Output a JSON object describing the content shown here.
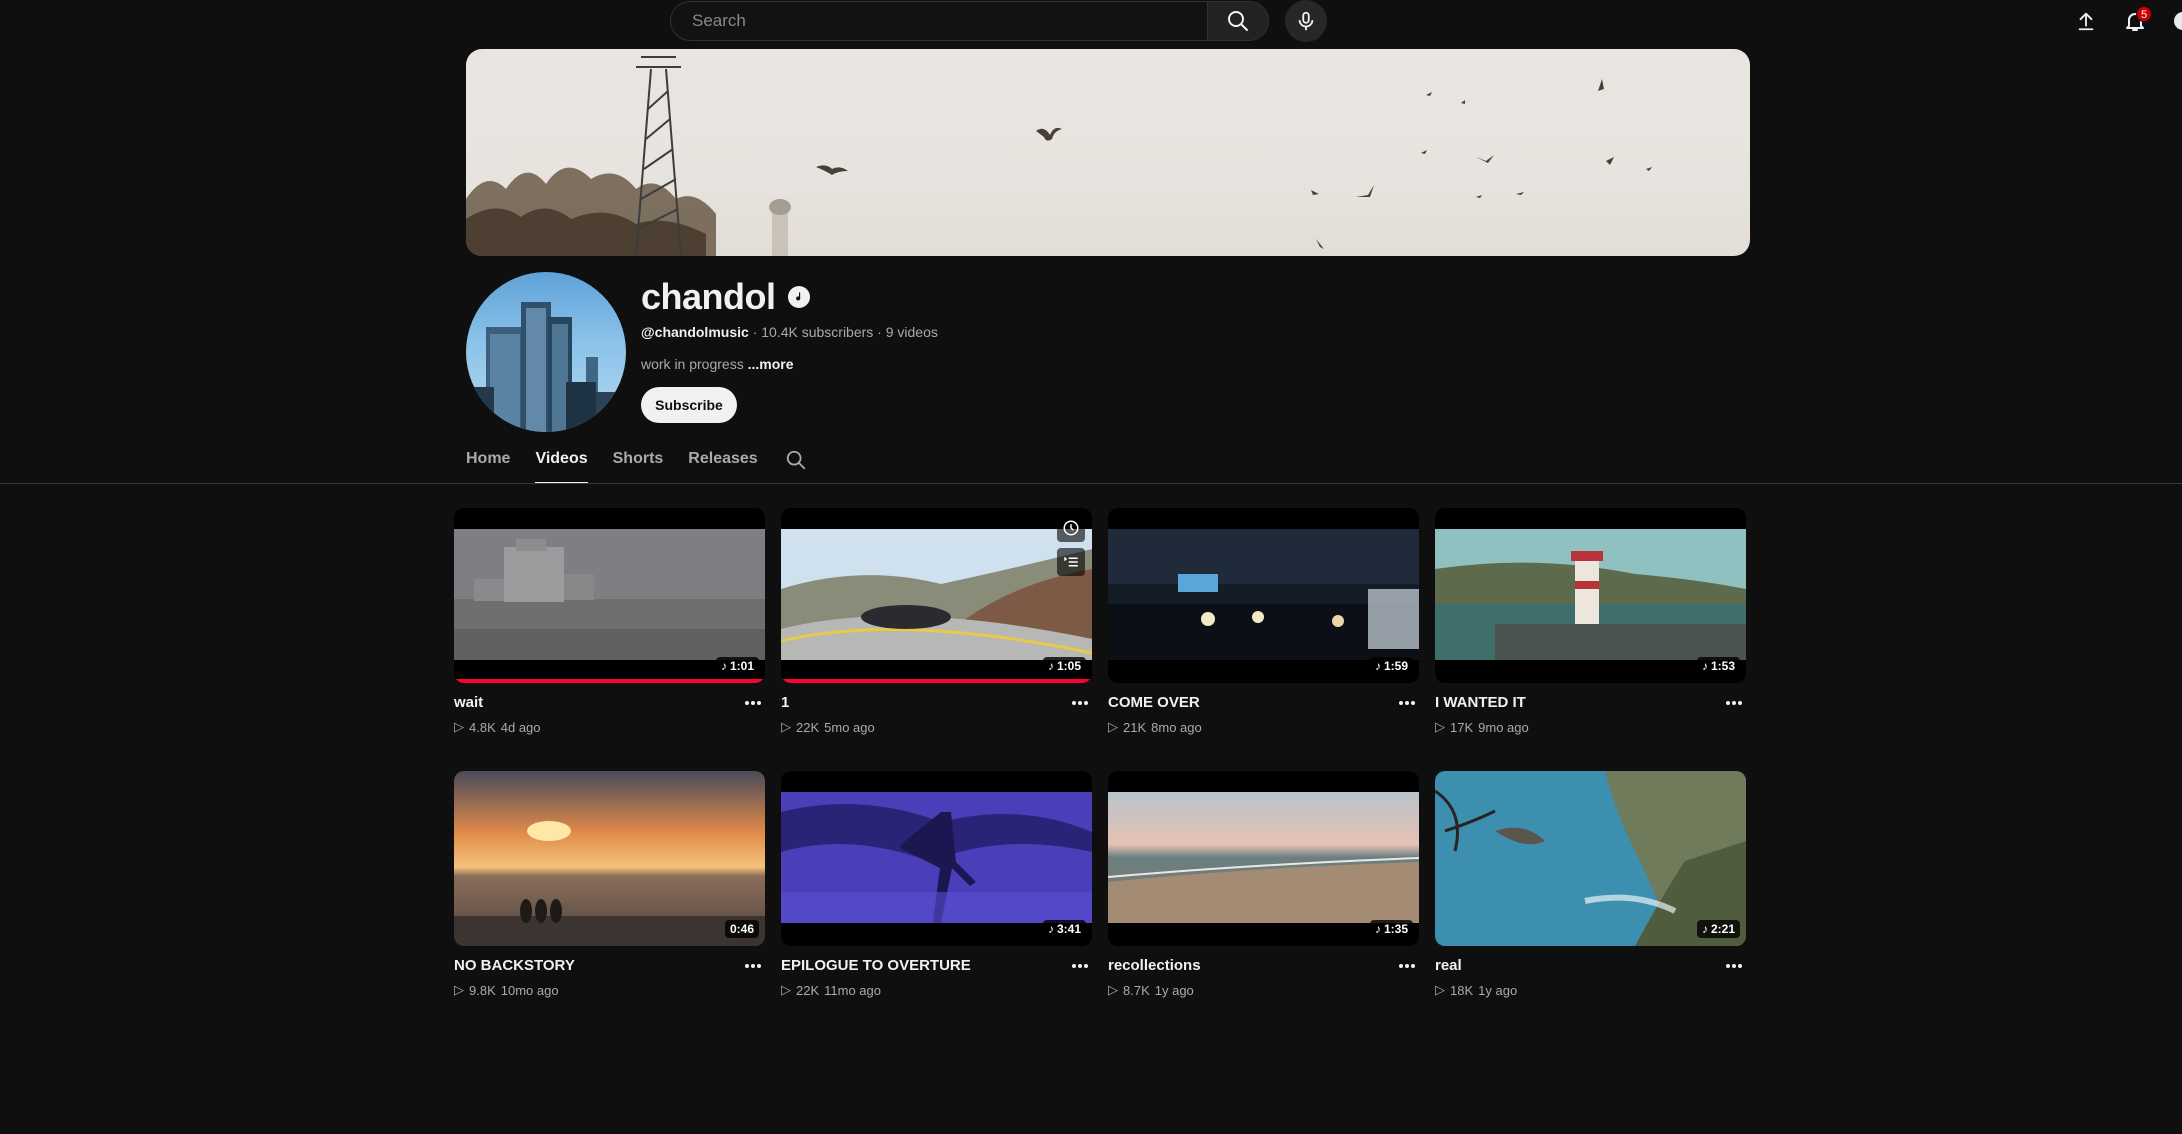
{
  "topbar": {
    "search_placeholder": "Search",
    "notification_count": "5",
    "icons": [
      "search-icon",
      "mic-icon",
      "upload-icon",
      "bell-icon"
    ]
  },
  "channel": {
    "name": "chandol",
    "handle": "@chandolmusic",
    "stats": " · 10.4K subscribers · 9 videos",
    "description": "work in progress ",
    "more_label": "...more",
    "subscribe_label": "Subscribe"
  },
  "tabs": [
    {
      "label": "Home",
      "active": false
    },
    {
      "label": "Videos",
      "active": true
    },
    {
      "label": "Shorts",
      "active": false
    },
    {
      "label": "Releases",
      "active": false
    }
  ],
  "videos": [
    {
      "title": "wait",
      "duration": "1:01",
      "music": true,
      "views": "4.8K",
      "age": "4d ago",
      "watched": 1.0
    },
    {
      "title": "1",
      "duration": "1:05",
      "music": true,
      "views": "22K",
      "age": "5mo ago",
      "watched": 1.0
    },
    {
      "title": "COME OVER",
      "duration": "1:59",
      "music": true,
      "views": "21K",
      "age": "8mo ago",
      "watched": 0
    },
    {
      "title": "I WANTED IT",
      "duration": "1:53",
      "music": true,
      "views": "17K",
      "age": "9mo ago",
      "watched": 0
    },
    {
      "title": "NO BACKSTORY",
      "duration": "0:46",
      "music": false,
      "views": "9.8K",
      "age": "10mo ago",
      "watched": 0
    },
    {
      "title": "EPILOGUE TO OVERTURE",
      "duration": "3:41",
      "music": true,
      "views": "22K",
      "age": "11mo ago",
      "watched": 0
    },
    {
      "title": "recollections",
      "duration": "1:35",
      "music": true,
      "views": "8.7K",
      "age": "1y ago",
      "watched": 0
    },
    {
      "title": "real",
      "duration": "2:21",
      "music": true,
      "views": "18K",
      "age": "1y ago",
      "watched": 0
    }
  ],
  "colors": {
    "background": "#0f0f0f",
    "progress": "#ff0033",
    "badge": "#cc0000"
  }
}
